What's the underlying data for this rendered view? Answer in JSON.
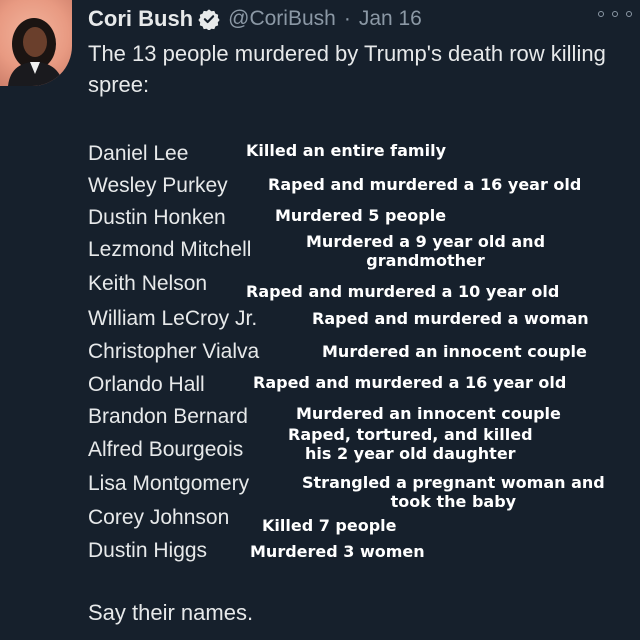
{
  "author": {
    "display_name": "Cori Bush",
    "handle": "@CoriBush",
    "separator": "·",
    "date": "Jan 16"
  },
  "tweet": {
    "intro": "The 13 people murdered by Trump's death row killing spree:",
    "closing": "Say their names."
  },
  "entries": [
    {
      "name": "Daniel Lee",
      "crime": "Killed an entire family"
    },
    {
      "name": "Wesley Purkey",
      "crime": "Raped and murdered a 16 year old"
    },
    {
      "name": "Dustin Honken",
      "crime": "Murdered 5 people"
    },
    {
      "name": "Lezmond Mitchell",
      "crime_line1": "Murdered a 9 year old and",
      "crime_line2": "grandmother"
    },
    {
      "name": "Keith Nelson",
      "crime": "Raped and murdered a 10 year old"
    },
    {
      "name": "William LeCroy Jr.",
      "crime": "Raped and murdered a woman"
    },
    {
      "name": "Christopher Vialva",
      "crime": "Murdered an innocent couple"
    },
    {
      "name": "Orlando Hall",
      "crime": "Raped and murdered a 16 year old"
    },
    {
      "name": "Brandon Bernard",
      "crime": "Murdered an innocent couple"
    },
    {
      "name": "Alfred Bourgeois",
      "crime_line1": "Raped, tortured, and killed",
      "crime_line2": "his 2 year old daughter"
    },
    {
      "name": "Lisa Montgomery",
      "crime_line1": "Strangled a pregnant woman and",
      "crime_line2": "took the baby"
    },
    {
      "name": "Corey Johnson",
      "crime": "Killed 7 people"
    },
    {
      "name": "Dustin Higgs",
      "crime": "Murdered 3 women"
    }
  ],
  "icons": {
    "verified": "verified-badge-icon",
    "more": "more-options-icon"
  },
  "colors": {
    "background": "#16202c",
    "text": "#e7e9ea",
    "secondary_text": "#8b98a5",
    "annotation": "#ffffff",
    "avatar_bg": "#e89a82"
  }
}
